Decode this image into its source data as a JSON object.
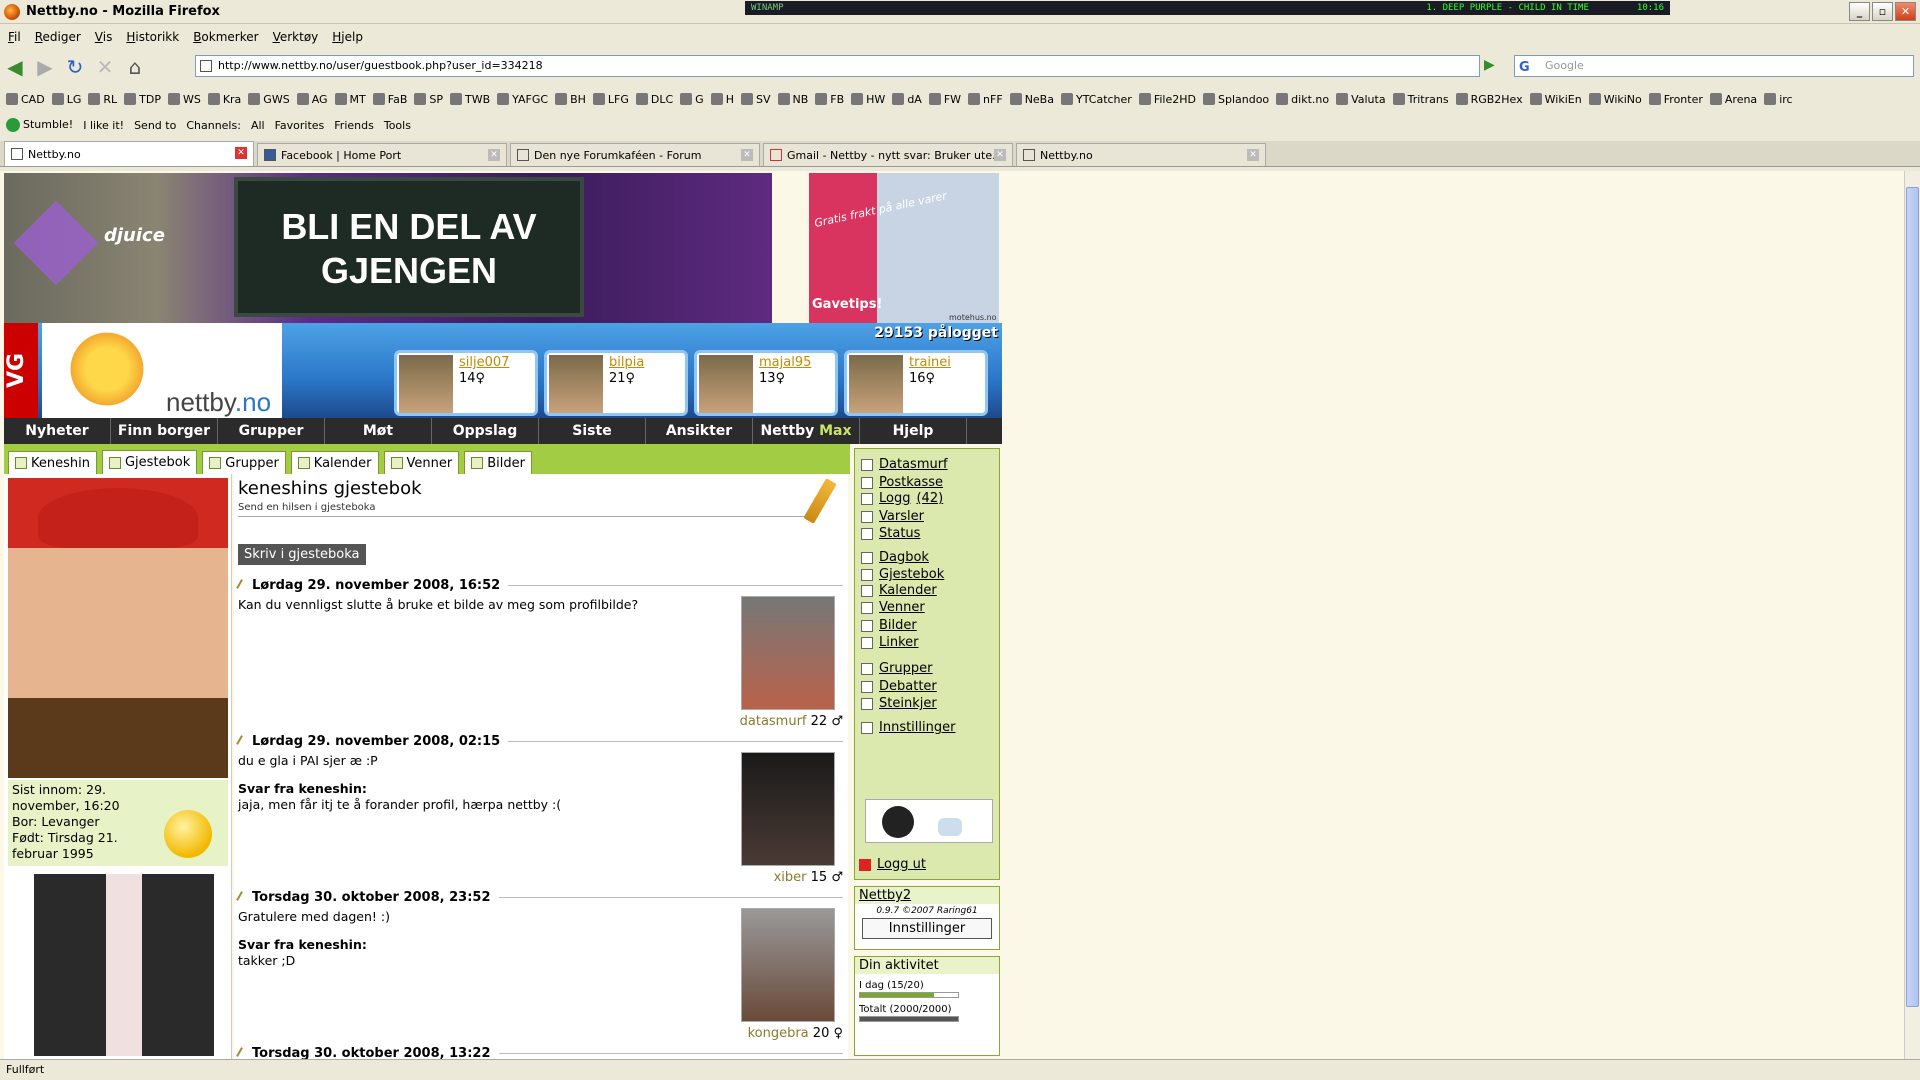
{
  "window": {
    "title": "Nettby.no - Mozilla Firefox"
  },
  "winamp": {
    "label": "WINAMP",
    "song": "1. DEEP PURPLE - CHILD IN TIME",
    "time": "10:16"
  },
  "menubar": [
    "Fil",
    "Rediger",
    "Vis",
    "Historikk",
    "Bokmerker",
    "Verktøy",
    "Hjelp"
  ],
  "nav": {
    "url": "http://www.nettby.no/user/guestbook.php?user_id=334218",
    "search_placeholder": "Google",
    "search_logo": "G"
  },
  "bookmarks": [
    "CAD",
    "LG",
    "RL",
    "TDP",
    "WS",
    "Kra",
    "GWS",
    "AG",
    "MT",
    "FaB",
    "SP",
    "TWB",
    "YAFGC",
    "BH",
    "LFG",
    "DLC",
    "G",
    "H",
    "SV",
    "NB",
    "FB",
    "HW",
    "dA",
    "FW",
    "nFF",
    "NeBa",
    "YTCatcher",
    "File2HD",
    "Splandoo",
    "dikt.no",
    "Valuta",
    "Tritrans",
    "RGB2Hex",
    "WikiEn",
    "WikiNo",
    "Fronter",
    "Arena",
    "irc"
  ],
  "stumble": {
    "items": [
      "Stumble!",
      "I like it!",
      "Send to",
      "Channels:",
      "All",
      "Favorites",
      "Friends",
      "Tools"
    ]
  },
  "tabs": [
    {
      "label": "Nettby.no",
      "active": true
    },
    {
      "label": "Facebook | Home Port",
      "active": false
    },
    {
      "label": "Den nye Forumkaféen - Forum",
      "active": false
    },
    {
      "label": "Gmail - Nettby - nytt svar: Bruker ute...",
      "active": false
    },
    {
      "label": "Nettby.no",
      "active": false
    }
  ],
  "ads": {
    "banner_text": "BLI EN DEL AV GJENGEN",
    "brand": "djuice",
    "side_free": "Gratis frakt på alle varer",
    "side_cta": "Gavetips!",
    "side_brand": "motehus.no"
  },
  "header": {
    "vg": "VG",
    "logo_part1": "nettby",
    "logo_part2": ".no",
    "online": "29153 pålogget",
    "users": [
      {
        "name": "silje007",
        "age": "14♀"
      },
      {
        "name": "bilpia",
        "age": "21♀"
      },
      {
        "name": "majal95",
        "age": "13♀"
      },
      {
        "name": "trainei",
        "age": "16♀"
      }
    ]
  },
  "mainnav": [
    "Nyheter",
    "Finn borger",
    "Grupper",
    "Møt",
    "Oppslag",
    "Siste",
    "Ansikter",
    "Nettby",
    "Hjelp"
  ],
  "mainnav_max": "Max",
  "subtabs": [
    "Keneshin",
    "Gjestebok",
    "Grupper",
    "Kalender",
    "Venner",
    "Bilder"
  ],
  "profile": {
    "last_seen": "Sist innom: 29. november, 16:20",
    "lives": "Bor: Levanger",
    "born": "Født: Tirsdag 21. februar 1995"
  },
  "guestbook": {
    "title": "keneshins gjestebok",
    "subtitle": "Send en hilsen i gjesteboka",
    "write_button": "Skriv i gjesteboka",
    "reply_label": "Svar fra keneshin:",
    "entries": [
      {
        "date": "Lørdag 29. november 2008, 16:52",
        "text": "Kan du vennligst slutte å bruke et bilde av meg som profilbilde?",
        "reply": "",
        "author": "datasmurf",
        "age": "22 ♂"
      },
      {
        "date": "Lørdag 29. november 2008, 02:15",
        "text": "du e gla i PAI sjer æ :P",
        "reply": "jaja, men får itj te å forander profil, hærpa nettby :(",
        "author": "xiber",
        "age": "15 ♂"
      },
      {
        "date": "Torsdag 30. oktober 2008, 23:52",
        "text": "Gratulere med dagen! :)",
        "reply": "takker ;D",
        "author": "kongebra",
        "age": "20 ♀"
      },
      {
        "date": "Torsdag 30. oktober 2008, 13:22",
        "text": "",
        "reply": "",
        "author": "",
        "age": ""
      }
    ]
  },
  "sidemenu": {
    "items": [
      {
        "label": "Datasmurf"
      },
      {
        "label": "Postkasse"
      },
      {
        "label": "Logg",
        "count": "(42)"
      },
      {
        "label": "Varsler"
      },
      {
        "label": "Status"
      },
      {
        "label": "Dagbok"
      },
      {
        "label": "Gjestebok"
      },
      {
        "label": "Kalender"
      },
      {
        "label": "Venner"
      },
      {
        "label": "Bilder"
      },
      {
        "label": "Linker"
      },
      {
        "label": "Grupper"
      },
      {
        "label": "Debatter"
      },
      {
        "label": "Steinkjer"
      },
      {
        "label": "Innstillinger"
      }
    ],
    "logout": "Logg ut"
  },
  "nettby2": {
    "title": "Nettby2",
    "version": "0.9.7 ©2007 Raring61",
    "button": "Innstillinger"
  },
  "activity": {
    "title": "Din aktivitet",
    "today_label": "I dag (15/20)",
    "today_fraction": 0.75,
    "total_label": "Totalt (2000/2000)",
    "total_fraction": 1.0
  },
  "status": {
    "text": "Fullført"
  }
}
